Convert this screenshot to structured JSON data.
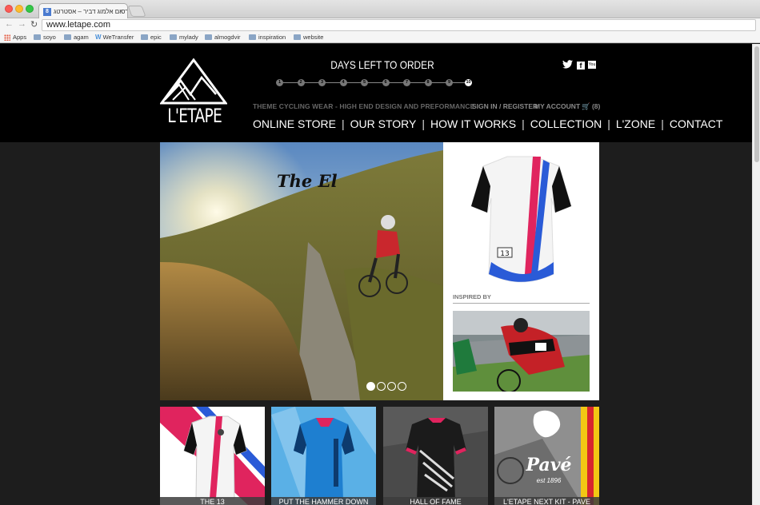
{
  "browser": {
    "tab_title": "פרסום אלמוג דביר – אסטרטג",
    "tab_favicon": "8",
    "url": "www.letape.com",
    "bookmarks": [
      {
        "label": "Apps",
        "icon": "apps-grid-icon"
      },
      {
        "label": "soyo",
        "icon": "folder-icon"
      },
      {
        "label": "agam",
        "icon": "folder-icon"
      },
      {
        "label": "WeTransfer",
        "icon": "wetransfer-icon"
      },
      {
        "label": "epic",
        "icon": "folder-icon"
      },
      {
        "label": "mylady",
        "icon": "folder-icon"
      },
      {
        "label": "almogdvir",
        "icon": "folder-icon"
      },
      {
        "label": "inspiration",
        "icon": "folder-icon"
      },
      {
        "label": "website",
        "icon": "folder-icon"
      }
    ]
  },
  "header": {
    "logo_text": "L'ETAPE",
    "days_title": "DAYS LEFT TO ORDER",
    "timeline": [
      "1",
      "2",
      "3",
      "4",
      "5",
      "6",
      "7",
      "8",
      "9",
      "10"
    ],
    "timeline_active": "10",
    "tagline": "THEME CYCLING WEAR - HIGH END DESIGN AND PREFORMANCE",
    "sign_in": "SIGN IN / REGISTER",
    "my_account": "MY ACCOUNT",
    "cart": "(8)",
    "social": {
      "twitter": "twitter-icon",
      "facebook": "f",
      "youtube": "You"
    },
    "nav": [
      "ONLINE STORE",
      "OUR STORY",
      "HOW IT WORKS",
      "COLLECTION",
      "L'ZONE",
      "CONTACT"
    ],
    "nav_separator": "|"
  },
  "hero": {
    "title": "The El",
    "slides": 4,
    "active_slide": 1
  },
  "side": {
    "inspired_label": "INSPIRED BY",
    "jersey_number": "13"
  },
  "tiles": [
    {
      "label": "THE 13"
    },
    {
      "label": "PUT THE HAMMER DOWN"
    },
    {
      "label": "HALL OF FAME"
    },
    {
      "label": "L'ETAPE NEXT KIT - PAVE",
      "badge_title": "Pavé",
      "badge_sub": "est 1896"
    }
  ],
  "colors": {
    "header_bg": "#000000",
    "page_bg": "#1d1d1d",
    "accent_red": "#e0245e"
  }
}
